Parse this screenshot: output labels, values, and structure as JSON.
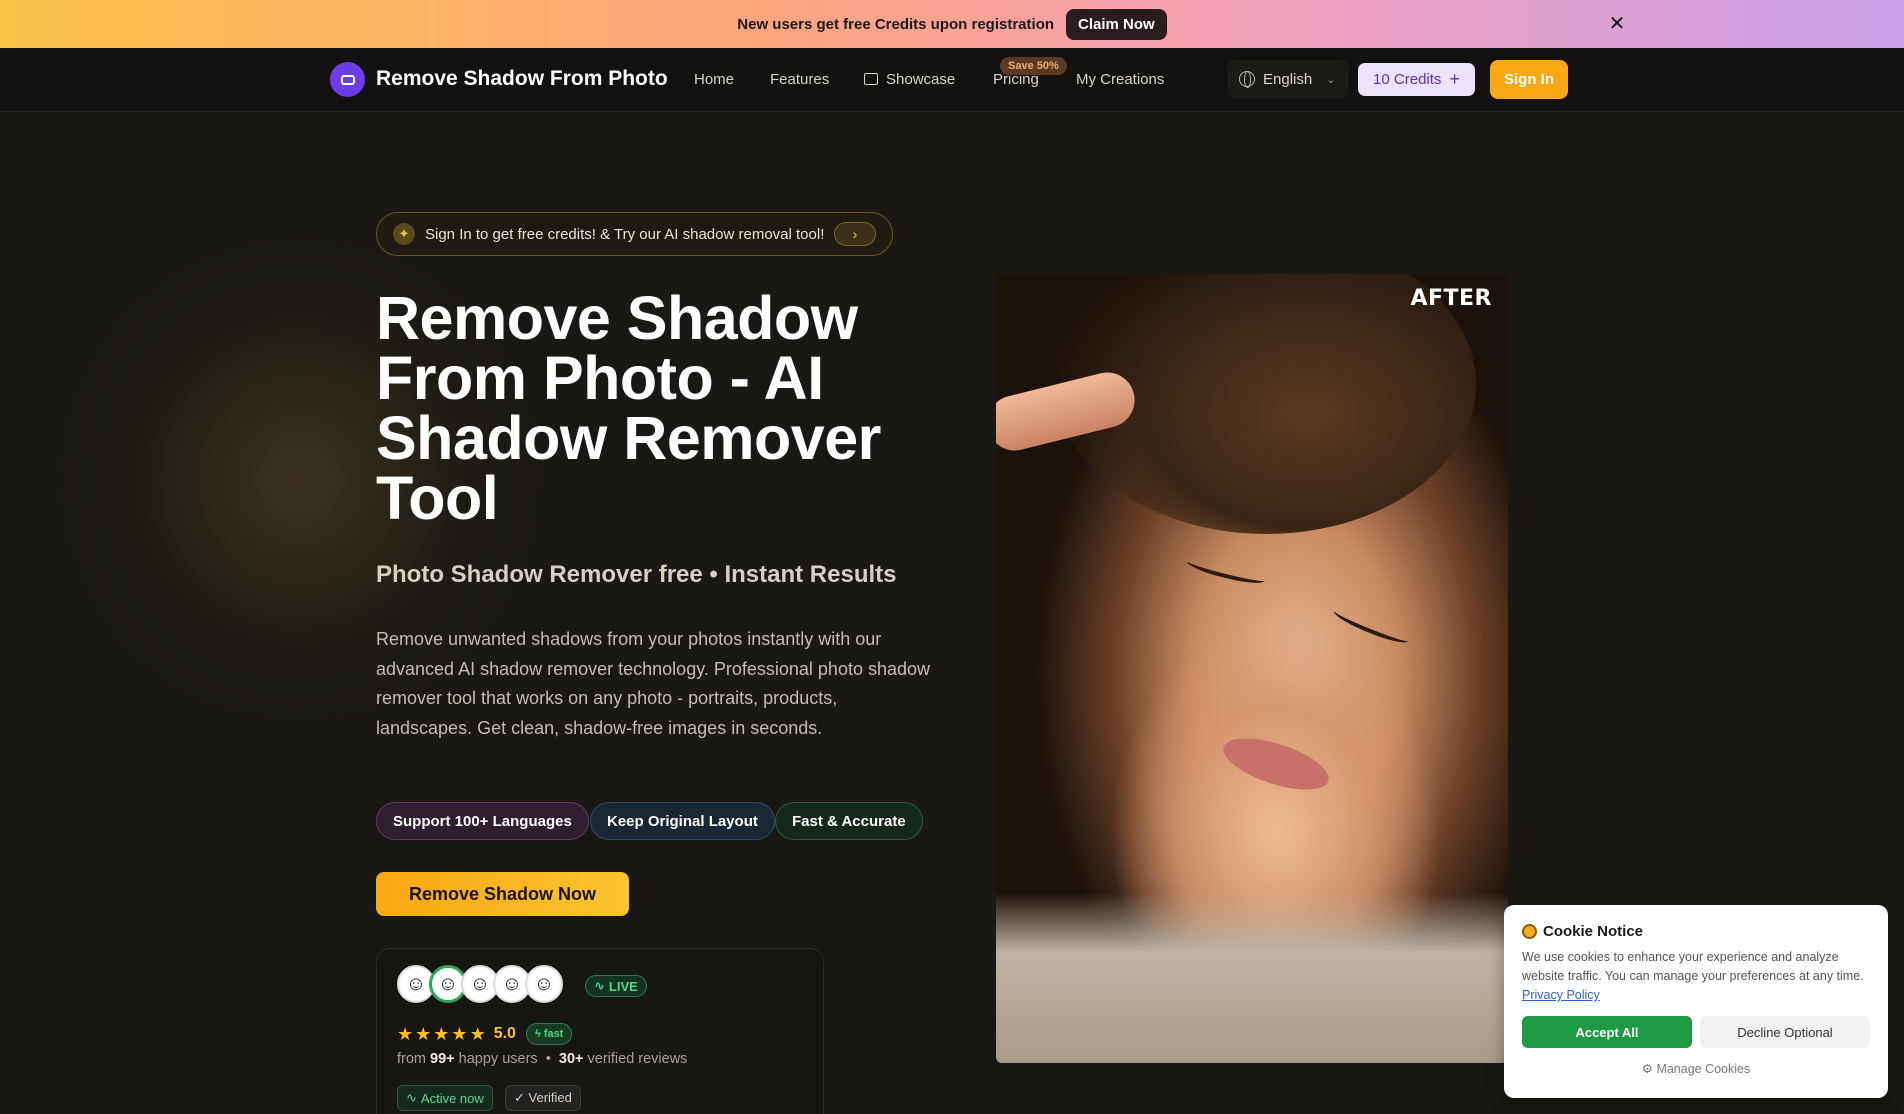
{
  "promo": {
    "text": "New users get free Credits upon registration",
    "button": "Claim Now",
    "close_icon": "close-icon"
  },
  "nav": {
    "logo_text": "Remove Shadow From Photo",
    "links": [
      "Home",
      "Features",
      "Showcase",
      "Pricing",
      "My Creations"
    ],
    "save_badge": "Save 50%",
    "language": "English",
    "credits": "10 Credits",
    "credits_icon": "+",
    "signin": "Sign In"
  },
  "hero": {
    "pill_text": "Sign In to get free credits! & Try our AI shadow removal tool!",
    "pill_arrow": "›",
    "title": "Remove Shadow From Photo - AI Shadow Remover Tool",
    "subtitle": "Photo Shadow Remover free • Instant Results",
    "description": "Remove unwanted shadows from your photos instantly with our advanced AI shadow remover technology. Professional photo shadow remover tool that works on any photo - portraits, products, landscapes. Get clean, shadow-free images in seconds.",
    "tags": [
      "Support 100+ Languages",
      "Keep Original Layout",
      "Fast & Accurate"
    ],
    "cta": "Remove Shadow Now"
  },
  "social_proof": {
    "live": "LIVE",
    "rating": "5.0",
    "rating_stars": 5,
    "fast": "fast",
    "users_prefix": "from",
    "users_count": "99+",
    "users_suffix": "happy users",
    "separator": "•",
    "reviews_count": "30+",
    "reviews_suffix": "verified reviews",
    "active": "Active now",
    "verified": "✓ Verified"
  },
  "image": {
    "label": "AFTER"
  },
  "cookie": {
    "title": "Cookie Notice",
    "body": "We use cookies to enhance your experience and analyze website traffic. You can manage your preferences at any time.",
    "link": "Privacy Policy",
    "accept": "Accept All",
    "decline": "Decline Optional",
    "manage": "Manage Cookies"
  },
  "colors": {
    "accent": "#f7a812",
    "brand": "#6a3ee8",
    "success": "#1e9a44",
    "background": "#1a1814"
  }
}
